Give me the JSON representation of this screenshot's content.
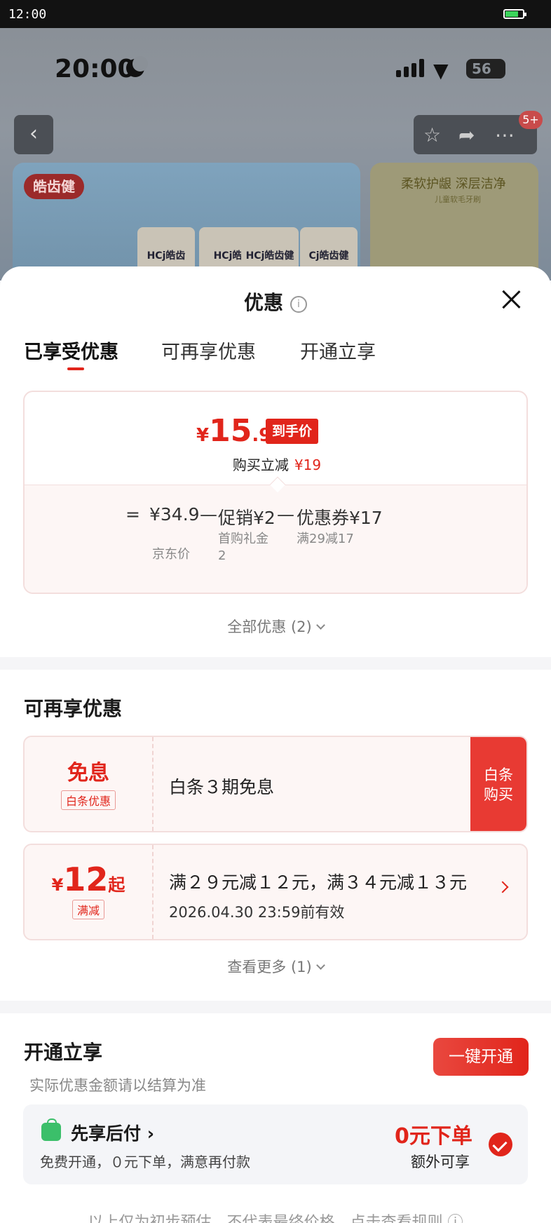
{
  "system": {
    "time": "12:00"
  },
  "background": {
    "phone_time": "20:00",
    "battery": "56",
    "cart_badge": "5+",
    "brand_logo": "皓齿健",
    "pack_labels": [
      "HCj皓齿",
      "HCj皓",
      "HCj皓齿健",
      "Cj皓齿健"
    ],
    "banner2_title": "柔软护龈 深层洁净",
    "banner2_sub": "儿童软毛牙刷"
  },
  "sheet": {
    "title": "优惠",
    "tabs": [
      "已享受优惠",
      "可再享优惠",
      "开通立享"
    ],
    "price": {
      "yen": "¥",
      "integer": "15",
      "decimal": ".9",
      "tag": "到手价",
      "reduce_label": "购买立减",
      "reduce_amount": "¥19"
    },
    "formula": {
      "eq": "=",
      "base": "¥34.9",
      "minus1": "—",
      "promo": "促销¥2",
      "minus2": "—",
      "coupon": "优惠券¥17",
      "base_label": "京东价",
      "promo_label": "首购礼金",
      "promo_label2": "2",
      "coupon_label": "满29减17"
    },
    "all_link": "全部优惠 (2)"
  },
  "more_offers": {
    "title": "可再享优惠",
    "baitiao": {
      "big": "免息",
      "tag": "白条优惠",
      "text": "白条３期免息",
      "btn_line1": "白条",
      "btn_line2": "购买"
    },
    "manjian": {
      "yen": "¥",
      "amount": "12",
      "suffix": "起",
      "tag": "满减",
      "text": "满２９元减１２元，满３４元减１３元",
      "valid": "2026.04.30 23:59前有效"
    },
    "more_link": "查看更多 (1)"
  },
  "open_section": {
    "title": "开通立享",
    "button": "一键开通",
    "note": "实际优惠金额请以结算为准",
    "pay_title": "先享后付",
    "pay_sub": "免费开通，０元下单，满意再付款",
    "zero_order": "0元下单",
    "extra": "额外可享"
  },
  "footer": "以上仅为初步预估，不代表最终价格，点击查看规则"
}
